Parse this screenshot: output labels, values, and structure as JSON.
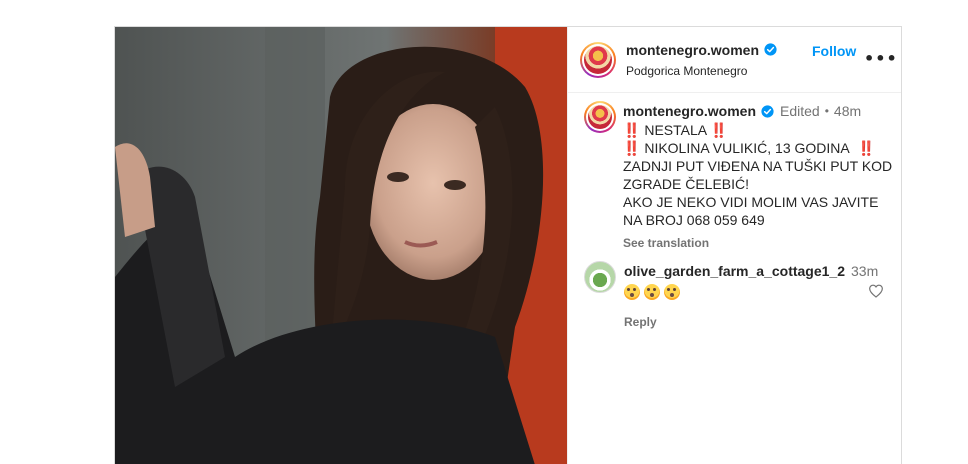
{
  "post": {
    "username": "montenegro.women",
    "location": "Podgorica Montenegro",
    "follow_label": "Follow",
    "more_label": "•••"
  },
  "caption": {
    "username": "montenegro.women",
    "edited": "Edited",
    "separator": "•",
    "time": "48m",
    "lines": [
      "NESTALA",
      "NIKOLINA VULIKIĆ, 13 GODINA",
      "ZADNJI PUT VIĐENA NA TUŠKI PUT KOD",
      "ZGRADE ČELEBIĆ!",
      "AKO JE NEKO VIDI MOLIM VAS JAVITE",
      "NA BROJ 068 059 649"
    ],
    "exclamation": "‼️",
    "see_translation": "See translation"
  },
  "comment": {
    "username": "olive_garden_farm_a_cottage1_2",
    "time": "33m",
    "emojis": [
      "flushed-face",
      "flushed-face",
      "flushed-face"
    ],
    "reply_label": "Reply"
  },
  "colors": {
    "accent": "#0095f6",
    "secondary_text": "#737373",
    "border": "#dbdbdb"
  }
}
